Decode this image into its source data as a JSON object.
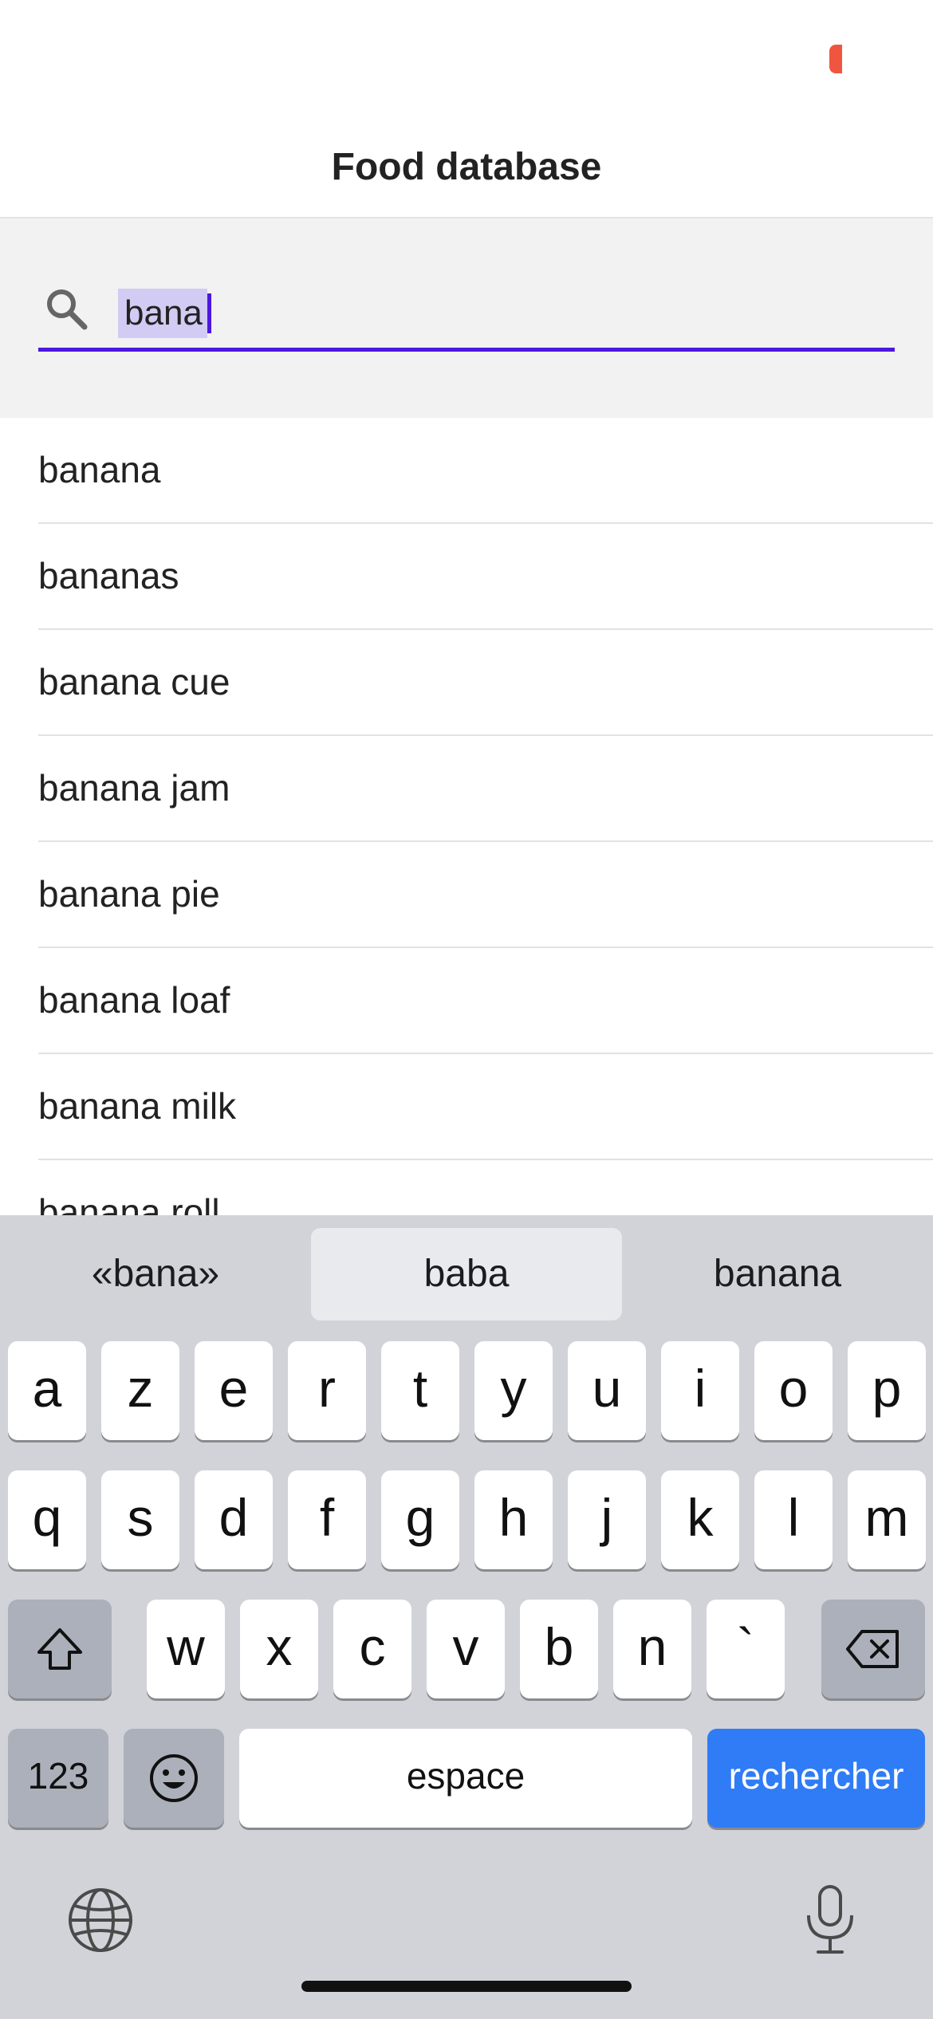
{
  "header": {
    "title": "Food database"
  },
  "search": {
    "value": "bana",
    "icon": "search-icon"
  },
  "results": [
    "banana",
    "bananas",
    "banana cue",
    "banana jam",
    "banana pie",
    "banana loaf",
    "banana milk",
    "banana roll"
  ],
  "keyboard": {
    "suggestions": [
      "«bana»",
      "baba",
      "banana"
    ],
    "row1": [
      "a",
      "z",
      "e",
      "r",
      "t",
      "y",
      "u",
      "i",
      "o",
      "p"
    ],
    "row2": [
      "q",
      "s",
      "d",
      "f",
      "g",
      "h",
      "j",
      "k",
      "l",
      "m"
    ],
    "row3": [
      "w",
      "x",
      "c",
      "v",
      "b",
      "n",
      "`"
    ],
    "numbers_label": "123",
    "space_label": "espace",
    "search_label": "rechercher"
  },
  "colors": {
    "accent": "#4d17e0",
    "search_highlight": "#d2cbf3",
    "key_blue": "#2f7cf6",
    "battery": "#f0563f"
  }
}
